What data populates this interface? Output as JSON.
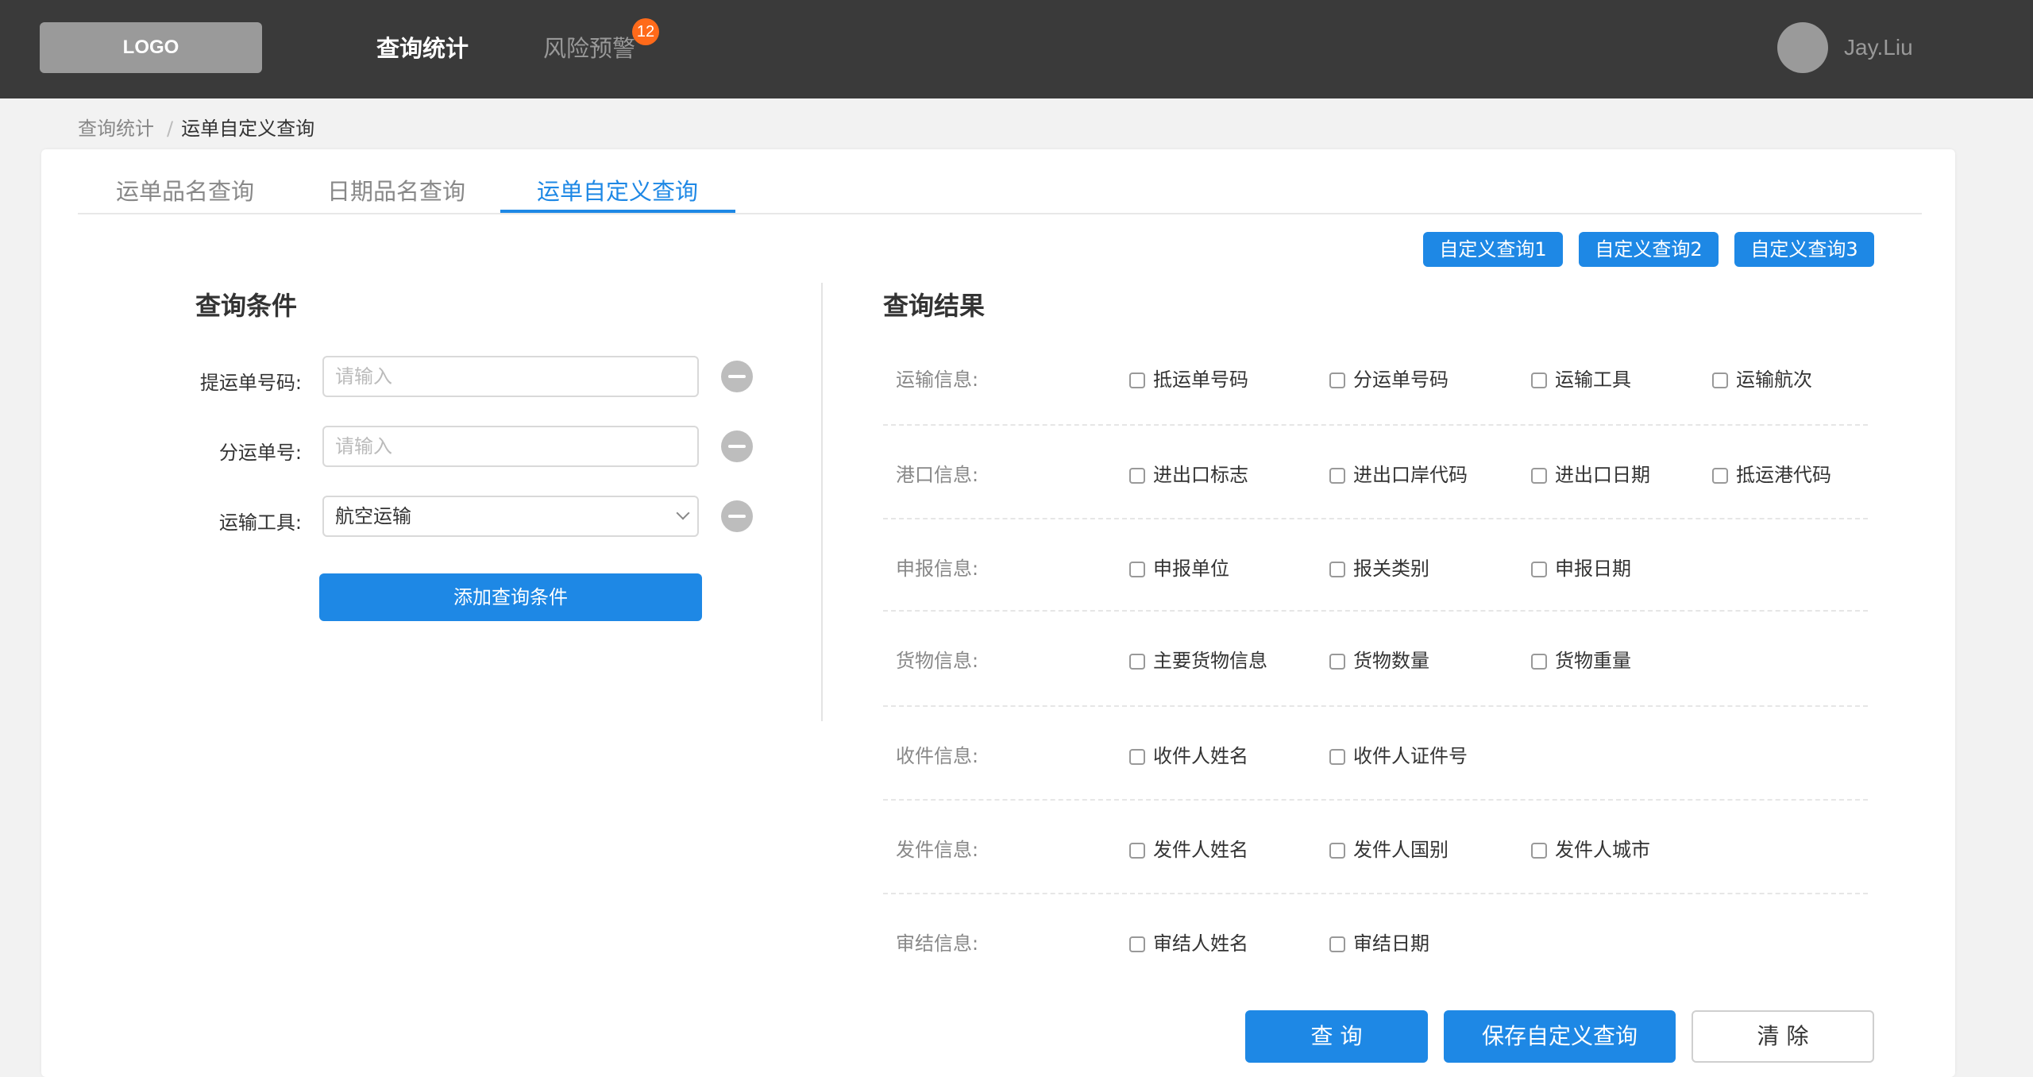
{
  "header": {
    "logo": "LOGO",
    "nav": [
      {
        "label": "查询统计",
        "active": true
      },
      {
        "label": "风险预警",
        "active": false,
        "badge": "12"
      }
    ],
    "user": {
      "name": "Jay.Liu"
    }
  },
  "breadcrumb": {
    "root": "查询统计",
    "separator": "/",
    "current": "运单自定义查询"
  },
  "tabs": [
    {
      "label": "运单品名查询",
      "active": false
    },
    {
      "label": "日期品名查询",
      "active": false
    },
    {
      "label": "运单自定义查询",
      "active": true
    }
  ],
  "presets": [
    "自定义查询1",
    "自定义查询2",
    "自定义查询3"
  ],
  "conditions": {
    "title": "查询条件",
    "fields": [
      {
        "label": "提运单号码:",
        "type": "text",
        "value": "",
        "placeholder": "请输入"
      },
      {
        "label": "分运单号:",
        "type": "text",
        "value": "",
        "placeholder": "请输入"
      },
      {
        "label": "运输工具:",
        "type": "select",
        "value": "航空运输"
      }
    ],
    "add_label": "添加查询条件"
  },
  "results": {
    "title": "查询结果",
    "groups": [
      {
        "label": "运输信息:",
        "options": [
          "抵运单号码",
          "分运单号码",
          "运输工具",
          "运输航次"
        ]
      },
      {
        "label": "港口信息:",
        "options": [
          "进出口标志",
          "进出口岸代码",
          "进出口日期",
          "抵运港代码"
        ]
      },
      {
        "label": "申报信息:",
        "options": [
          "申报单位",
          "报关类别",
          "申报日期"
        ]
      },
      {
        "label": "货物信息:",
        "options": [
          "主要货物信息",
          "货物数量",
          "货物重量"
        ]
      },
      {
        "label": "收件信息:",
        "options": [
          "收件人姓名",
          "收件人证件号"
        ]
      },
      {
        "label": "发件信息:",
        "options": [
          "发件人姓名",
          "发件人国别",
          "发件人城市"
        ]
      },
      {
        "label": "审结信息:",
        "options": [
          "审结人姓名",
          "审结日期"
        ]
      }
    ]
  },
  "actions": {
    "query": "查 询",
    "save": "保存自定义查询",
    "clear": "清 除"
  },
  "colors": {
    "primary": "#1e88e5",
    "header_bg": "#3a3a3a",
    "badge": "#ff6a1a"
  }
}
